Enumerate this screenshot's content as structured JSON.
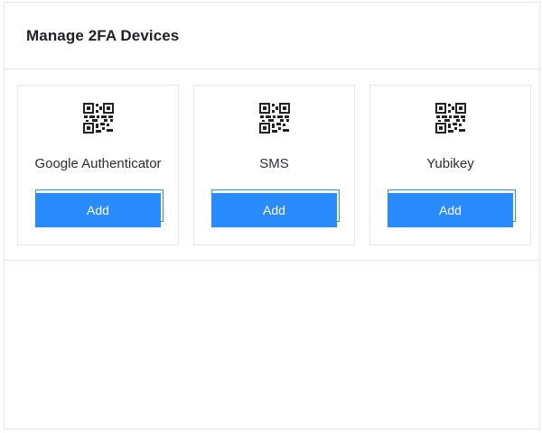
{
  "panel": {
    "title": "Manage 2FA Devices"
  },
  "devices": [
    {
      "name": "Google Authenticator",
      "icon": "qr-code-icon",
      "button_label": "Add"
    },
    {
      "name": "SMS",
      "icon": "qr-code-icon",
      "button_label": "Add"
    },
    {
      "name": "Yubikey",
      "icon": "qr-code-icon",
      "button_label": "Add"
    }
  ],
  "colors": {
    "accent": "#2a8bff",
    "border": "#e3e6ea",
    "text": "#1d2126"
  }
}
